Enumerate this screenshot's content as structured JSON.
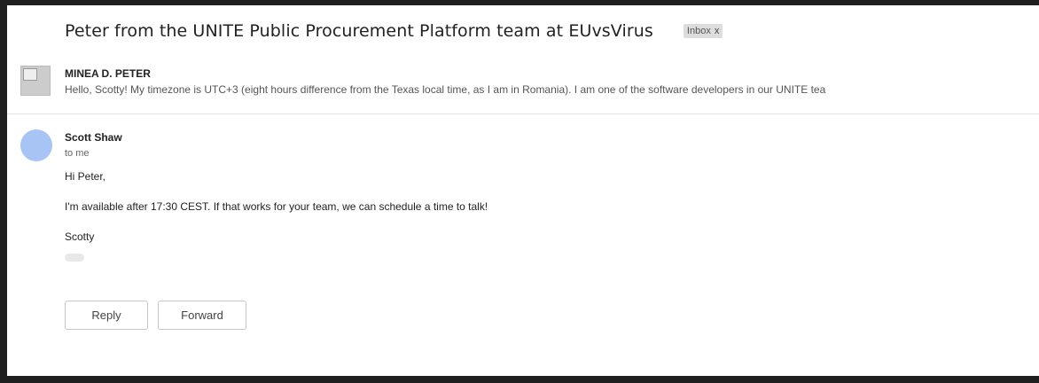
{
  "thread": {
    "subject": "Peter from the UNITE Public Procurement Platform team at EUvsVirus",
    "label": "Inbox",
    "label_remove": "x"
  },
  "messages": [
    {
      "sender": "MINEA D. PETER",
      "snippet": "Hello, Scotty! My timezone is UTC+3 (eight hours difference from the Texas local time, as I am in Romania). I am one of the software developers in our UNITE tea"
    },
    {
      "sender": "Scott Shaw",
      "recipient": "to me",
      "body": [
        "Hi Peter,",
        "I'm available after 17:30 CEST. If that works for your team, we can schedule a time to talk!",
        "Scotty"
      ]
    }
  ],
  "actions": {
    "reply_label": "Reply",
    "forward_label": "Forward"
  },
  "colors": {
    "avatar_scott": "#a8c4f5",
    "frame": "#1f1f1f"
  }
}
